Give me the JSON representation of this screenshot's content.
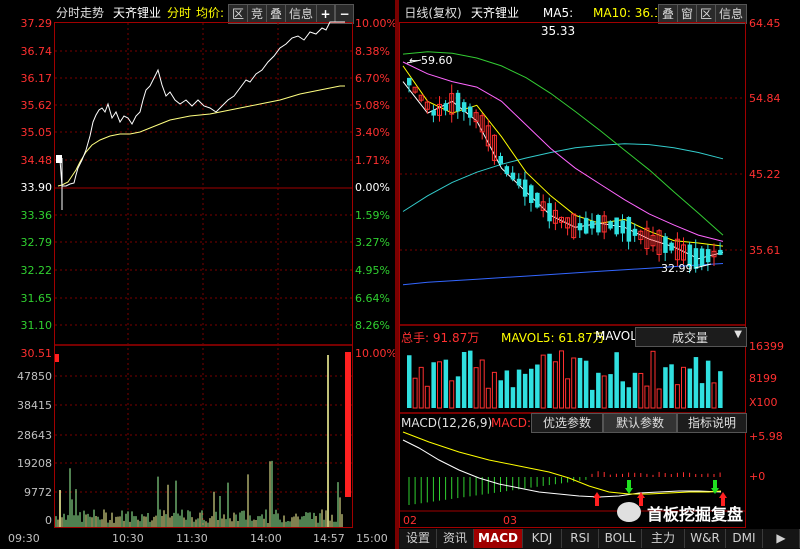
{
  "left_header": {
    "title": "分时走势",
    "stock": "天齐锂业",
    "mode": "分时",
    "avg_label": "均价:",
    "buttons": [
      "区",
      "竞",
      "叠",
      "信息"
    ],
    "plus": "+",
    "minus": "−"
  },
  "intraday": {
    "price_axis": [
      "37.29",
      "36.74",
      "36.17",
      "35.62",
      "35.05",
      "34.48",
      "33.90",
      "33.36",
      "32.79",
      "32.22",
      "31.65",
      "31.10"
    ],
    "pct_axis": [
      "10.00%",
      "8.38%",
      "6.70%",
      "5.08%",
      "3.40%",
      "1.71%",
      "0.00%",
      "1.59%",
      "3.27%",
      "4.95%",
      "6.64%",
      "8.26%"
    ],
    "vol_top_price": "30.51",
    "vol_top_pct": "10.00%",
    "vol_axis": [
      "47850",
      "38415",
      "28643",
      "19208",
      "9772",
      "0"
    ],
    "time_axis": [
      "09:30",
      "10:30",
      "11:30",
      "14:00",
      "14:57",
      "15:00"
    ]
  },
  "right_header": {
    "title": "日线(复权)",
    "stock": "天齐锂业",
    "ma5_label": "MA5: 35.33",
    "ma10_label": "MA10: 36.1",
    "buttons": [
      "叠",
      "窗",
      "区",
      "信息"
    ],
    "colors": {
      "ma5": "#ffffff",
      "ma10": "#ffff00",
      "ma20": "#ff66ff",
      "ma60": "#33cc33",
      "ma120": "#33cccc",
      "ma250": "#3366ff"
    }
  },
  "kline": {
    "price_axis": [
      "64.45",
      "54.84",
      "45.22",
      "35.61"
    ],
    "high_label": "59.60",
    "low_label": "32.99",
    "ma250": [
      31.2,
      31.5,
      31.7,
      31.9,
      32.1,
      32.3,
      32.5,
      32.7,
      32.9,
      33.1,
      33.3,
      33.5,
      33.7,
      33.9
    ],
    "ma120": [
      40.5,
      42.5,
      44.2,
      45.5,
      46.5,
      47.3,
      48.0,
      48.6,
      48.9,
      49.1,
      49.0,
      48.6,
      48.0,
      47.2
    ],
    "ma60": [
      60.5,
      60.8,
      60.6,
      60.0,
      59.0,
      57.5,
      55.5,
      53.2,
      50.8,
      48.3,
      45.8,
      43.0,
      40.3,
      37.5
    ],
    "ma20": [
      59.5,
      58.0,
      57.0,
      56.3,
      54.5,
      51.5,
      48.5,
      46.0,
      44.0,
      42.0,
      40.2,
      38.8,
      37.5,
      36.7
    ],
    "ma10": [
      59.0,
      54.5,
      53.0,
      54.0,
      50.0,
      45.5,
      42.5,
      40.0,
      39.0,
      39.5,
      38.0,
      36.8,
      36.5,
      36.1
    ],
    "ma5": [
      57.0,
      53.0,
      54.5,
      52.0,
      46.0,
      43.0,
      40.0,
      38.5,
      39.0,
      38.5,
      37.0,
      36.0,
      34.5,
      35.3
    ]
  },
  "volume_panel": {
    "total_label": "总手: 91.87万",
    "mavol5_label": "MAVOL5: 61.87万",
    "mavol_label": "MAVOL",
    "dropdown": "成交量",
    "axis": [
      "16399",
      "8199",
      "X100"
    ]
  },
  "macd_panel": {
    "title": "MACD(12,26,9)",
    "title2": "MACD:",
    "buttons": [
      "优选参数",
      "默认参数",
      "指标说明"
    ],
    "axis": [
      "+5.98",
      "+0"
    ]
  },
  "months": [
    "02",
    "03"
  ],
  "tabs": [
    "设置",
    "资讯",
    "MACD",
    "KDJ",
    "RSI",
    "BOLL",
    "主力",
    "W&R",
    "DMI"
  ],
  "watermark": "首板挖掘复盘"
}
